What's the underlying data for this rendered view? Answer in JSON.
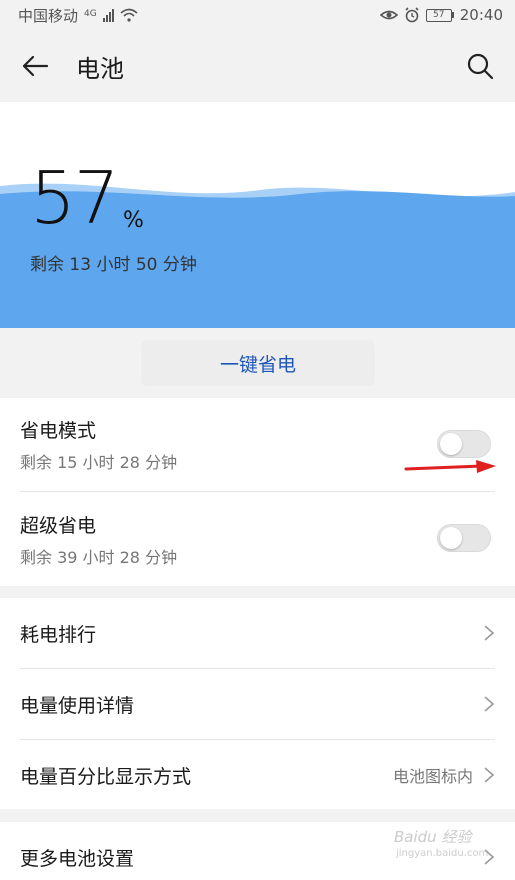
{
  "status_bar": {
    "carrier": "中国移动",
    "network": "4G",
    "battery_level": "57",
    "time": "20:40"
  },
  "header": {
    "title": "电池"
  },
  "battery": {
    "percent": "57",
    "unit": "%",
    "remaining": "剩余 13 小时 50 分钟",
    "wave_color": "#5ea7ef"
  },
  "one_key_button": "一键省电",
  "power_modes": [
    {
      "title": "省电模式",
      "remaining": "剩余 15 小时 28 分钟",
      "enabled": false
    },
    {
      "title": "超级省电",
      "remaining": "剩余 39 小时 28 分钟",
      "enabled": false
    }
  ],
  "menu": [
    {
      "label": "耗电排行",
      "value": ""
    },
    {
      "label": "电量使用详情",
      "value": ""
    },
    {
      "label": "电量百分比显示方式",
      "value": "电池图标内"
    }
  ],
  "more_settings": "更多电池设置",
  "watermark": {
    "text": "Baidu 经验",
    "url": "jingyan.baidu.com"
  },
  "colors": {
    "accent": "#1f57b8",
    "background": "#f2f2f2",
    "annotation_arrow": "#e02020"
  }
}
